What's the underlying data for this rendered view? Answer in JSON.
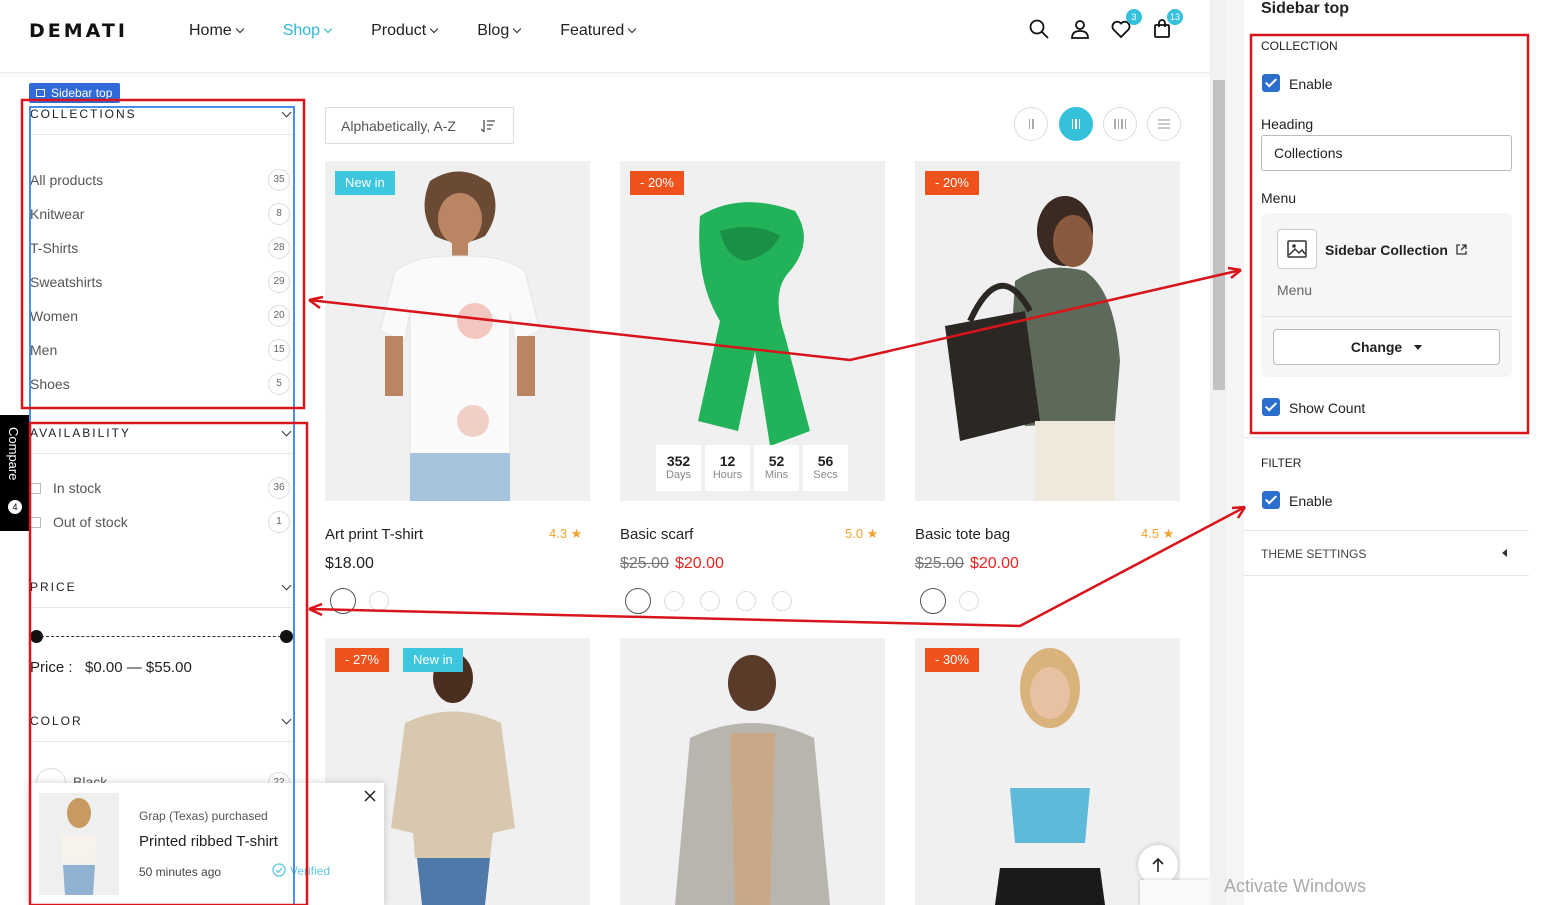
{
  "header": {
    "logo": "DEMATI",
    "nav": [
      {
        "label": "Home"
      },
      {
        "label": "Shop"
      },
      {
        "label": "Product"
      },
      {
        "label": "Blog"
      },
      {
        "label": "Featured"
      }
    ],
    "wishlist_count": "3",
    "cart_count": "13",
    "active_color": "#2cb8d6"
  },
  "sidebar": {
    "chip_label": "Sidebar top",
    "collections": {
      "heading": "COLLECTIONS",
      "items": [
        {
          "label": "All products",
          "count": "35"
        },
        {
          "label": "Knitwear",
          "count": "8"
        },
        {
          "label": "T-Shirts",
          "count": "28"
        },
        {
          "label": "Sweatshirts",
          "count": "29"
        },
        {
          "label": "Women",
          "count": "20"
        },
        {
          "label": "Men",
          "count": "15"
        },
        {
          "label": "Shoes",
          "count": "5"
        }
      ]
    },
    "availability": {
      "heading": "AVAILABILITY",
      "items": [
        {
          "label": "In stock",
          "count": "36"
        },
        {
          "label": "Out of stock",
          "count": "1"
        }
      ]
    },
    "price": {
      "heading": "PRICE",
      "label": "Price :",
      "range": "$0.00 — $55.00"
    },
    "color": {
      "heading": "COLOR",
      "first_item": "Black",
      "first_count": "22"
    },
    "compare": {
      "label": "Compare",
      "count": "4"
    }
  },
  "toolbar": {
    "sort_label": "Alphabetically, A-Z"
  },
  "products": [
    {
      "name": "Art print T-shirt",
      "rating": "4.3 ★",
      "price": "$18.00",
      "tags": [
        "New in"
      ]
    },
    {
      "name": "Basic scarf",
      "rating": "5.0 ★",
      "old_price": "$25.00",
      "price": "$20.00",
      "tags": [
        "- 20%"
      ],
      "countdown": [
        {
          "value": "352",
          "unit": "Days"
        },
        {
          "value": "12",
          "unit": "Hours"
        },
        {
          "value": "52",
          "unit": "Mins"
        },
        {
          "value": "56",
          "unit": "Secs"
        }
      ]
    },
    {
      "name": "Basic tote bag",
      "rating": "4.5 ★",
      "old_price": "$25.00",
      "price": "$20.00",
      "tags": [
        "- 20%"
      ]
    },
    {
      "tags": [
        "- 27%",
        "New in"
      ]
    },
    {
      "tags": []
    },
    {
      "tags": [
        "- 30%"
      ]
    }
  ],
  "popup": {
    "purchased_by": "Grap (Texas) purchased",
    "product": "Printed ribbed T-shirt",
    "time": "50 minutes ago",
    "verified": "Verified"
  },
  "panel": {
    "title": "Sidebar top",
    "collection_section": "COLLECTION",
    "enable_label": "Enable",
    "heading_label": "Heading",
    "heading_value": "Collections",
    "menu_label": "Menu",
    "menu_name": "Sidebar Collection",
    "menu_sub": "Menu",
    "change_label": "Change",
    "show_count_label": "Show Count",
    "filter_section": "FILTER",
    "filter_enable_label": "Enable",
    "theme_settings": "THEME SETTINGS"
  },
  "watermark": "Activate Windows",
  "colors": {
    "accent": "#35c0dc",
    "sale": "#f0521d",
    "annotation_red": "#d9141b",
    "annotation_blue": "#4a8fe7",
    "check_blue": "#2c6ecb"
  }
}
